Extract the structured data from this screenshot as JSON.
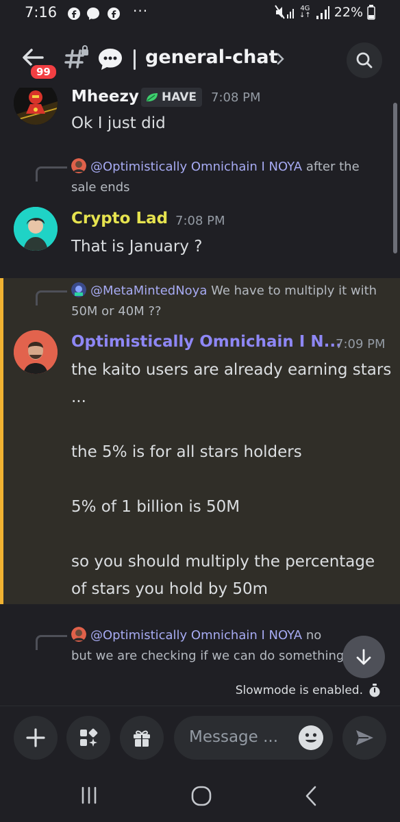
{
  "status_bar": {
    "time": "7:16",
    "dots": "···",
    "network": "4G",
    "battery": "22%"
  },
  "header": {
    "badge_count": "99",
    "channel": "general-chat"
  },
  "messages": [
    {
      "username": "Mheezy",
      "username_color": "#f2f3f5",
      "role_tag": "HAVE",
      "time": "7:08 PM",
      "text": "Ok I just did"
    },
    {
      "reply_to": "@Optimistically Omnichain I NOYA",
      "reply_text": " after the sale ends",
      "username": "Crypto Lad",
      "username_color": "#e6e34f",
      "time": "7:08 PM",
      "text": "That is January ?"
    },
    {
      "reply_to": "@MetaMintedNoya",
      "reply_text": " We have to multiply it with 50M or 40M ??",
      "username": "Optimistically Omnichain I N...",
      "username_color": "#8e87f5",
      "time": "7:09 PM",
      "text": "the kaito users are already earning stars ...\n\nthe 5% is for all stars holders\n\n5% of 1 billion is 50M\n\nso you should multiply the percentage of stars you hold by 50m"
    },
    {
      "reply_to": "@Optimistically Omnichain I NOYA",
      "reply_text": " no but we are checking if we can do something for"
    }
  ],
  "slowmode": "Slowmode is enabled.",
  "input": {
    "placeholder": "Message ..."
  },
  "colors": {
    "background": "#1f1f24",
    "highlight_bar": "#f0b232",
    "mention": "#a7abf3"
  }
}
